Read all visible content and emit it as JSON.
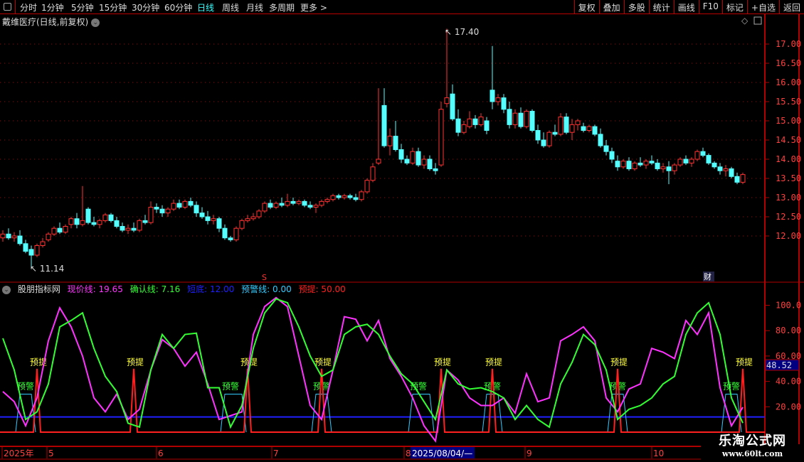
{
  "toolbar": {
    "periods": [
      "分时",
      "1分钟",
      "5分钟",
      "15分钟",
      "30分钟",
      "60分钟",
      "日线",
      "周线",
      "月线",
      "多周期",
      "更多 >"
    ],
    "active": "日线",
    "right_buttons": [
      "复权",
      "叠加",
      "多股",
      "统计",
      "画线",
      "F10",
      "标记",
      "+自选",
      "返回"
    ]
  },
  "title": "戴维医疗(日线,前复权)",
  "price_axis": {
    "ticks": [
      "17.00",
      "16.50",
      "16.00",
      "15.50",
      "15.00",
      "14.50",
      "14.00",
      "13.50",
      "13.00",
      "12.50",
      "12.00"
    ]
  },
  "annotations": {
    "high": "17.40",
    "low": "11.14",
    "s_marker": "S",
    "cai_marker": "财"
  },
  "colors": {
    "up": "#ff3232",
    "down": "#54ffff",
    "frame": "#b00000",
    "axis_text": "#ff4040",
    "xianjia": "#ff33ff",
    "queren": "#33ff33",
    "duandi": "#1f1fff",
    "yujing": "#33ccff",
    "yuti": "#ff2020",
    "label_yellow": "#ffff33"
  },
  "chart_data": [
    {
      "type": "candlestick",
      "title": "戴维医疗(日线,前复权)",
      "ylim": [
        11.0,
        17.6
      ],
      "candles": [
        [
          11.95,
          12.15,
          11.85,
          12.05
        ],
        [
          12.05,
          12.2,
          11.9,
          11.95
        ],
        [
          11.95,
          12.1,
          11.85,
          12.0
        ],
        [
          12.0,
          12.15,
          11.75,
          11.8
        ],
        [
          11.8,
          11.9,
          11.55,
          11.6
        ],
        [
          11.65,
          11.75,
          11.14,
          11.5
        ],
        [
          11.5,
          11.8,
          11.45,
          11.75
        ],
        [
          11.75,
          11.95,
          11.7,
          11.85
        ],
        [
          11.9,
          12.1,
          11.85,
          12.05
        ],
        [
          12.05,
          12.25,
          12.0,
          12.2
        ],
        [
          12.2,
          12.35,
          12.05,
          12.1
        ],
        [
          12.1,
          12.3,
          12.05,
          12.25
        ],
        [
          12.3,
          12.5,
          12.2,
          12.45
        ],
        [
          12.45,
          12.6,
          12.2,
          12.3
        ],
        [
          12.3,
          13.3,
          12.25,
          12.4
        ],
        [
          12.7,
          12.75,
          12.3,
          12.35
        ],
        [
          12.35,
          12.5,
          12.25,
          12.3
        ],
        [
          12.3,
          12.45,
          12.2,
          12.4
        ],
        [
          12.4,
          12.6,
          12.35,
          12.55
        ],
        [
          12.55,
          12.6,
          12.35,
          12.4
        ],
        [
          12.4,
          12.5,
          12.2,
          12.25
        ],
        [
          12.25,
          12.35,
          12.1,
          12.15
        ],
        [
          12.15,
          12.3,
          12.05,
          12.2
        ],
        [
          12.2,
          12.35,
          12.1,
          12.15
        ],
        [
          12.15,
          12.45,
          12.1,
          12.4
        ],
        [
          12.4,
          12.55,
          12.3,
          12.35
        ],
        [
          12.35,
          12.9,
          12.3,
          12.75
        ],
        [
          12.75,
          12.85,
          12.6,
          12.7
        ],
        [
          12.7,
          12.8,
          12.5,
          12.6
        ],
        [
          12.6,
          12.75,
          12.5,
          12.7
        ],
        [
          12.7,
          12.95,
          12.65,
          12.85
        ],
        [
          12.85,
          12.95,
          12.7,
          12.75
        ],
        [
          12.75,
          12.95,
          12.7,
          12.9
        ],
        [
          12.9,
          13.0,
          12.75,
          12.8
        ],
        [
          12.8,
          12.9,
          12.5,
          12.6
        ],
        [
          12.6,
          12.75,
          12.45,
          12.5
        ],
        [
          12.5,
          12.65,
          12.3,
          12.4
        ],
        [
          12.4,
          12.55,
          12.3,
          12.45
        ],
        [
          12.45,
          12.5,
          12.1,
          12.2
        ],
        [
          12.2,
          12.3,
          11.9,
          11.95
        ],
        [
          11.95,
          12.0,
          11.85,
          11.9
        ],
        [
          11.9,
          12.25,
          11.85,
          12.2
        ],
        [
          12.2,
          12.45,
          12.15,
          12.4
        ],
        [
          12.4,
          12.55,
          12.35,
          12.45
        ],
        [
          12.45,
          12.6,
          12.4,
          12.5
        ],
        [
          12.5,
          12.7,
          12.45,
          12.65
        ],
        [
          12.65,
          12.9,
          12.6,
          12.85
        ],
        [
          12.85,
          12.95,
          12.7,
          12.75
        ],
        [
          12.75,
          12.9,
          12.7,
          12.85
        ],
        [
          12.85,
          13.0,
          12.75,
          12.8
        ],
        [
          12.8,
          13.1,
          12.75,
          12.9
        ],
        [
          12.9,
          13.0,
          12.8,
          12.85
        ],
        [
          12.85,
          12.95,
          12.8,
          12.9
        ],
        [
          12.9,
          12.95,
          12.75,
          12.8
        ],
        [
          12.8,
          12.9,
          12.7,
          12.75
        ],
        [
          12.75,
          12.85,
          12.6,
          12.8
        ],
        [
          12.8,
          12.95,
          12.75,
          12.9
        ],
        [
          12.9,
          13.0,
          12.85,
          12.95
        ],
        [
          12.95,
          13.1,
          12.9,
          13.05
        ],
        [
          13.05,
          13.1,
          12.95,
          13.0
        ],
        [
          13.0,
          13.1,
          12.95,
          13.05
        ],
        [
          13.05,
          13.1,
          12.95,
          13.0
        ],
        [
          13.0,
          13.1,
          12.9,
          12.95
        ],
        [
          12.95,
          13.2,
          12.9,
          13.15
        ],
        [
          13.15,
          13.5,
          13.1,
          13.45
        ],
        [
          13.45,
          13.9,
          13.4,
          13.8
        ],
        [
          13.9,
          15.85,
          13.85,
          14.0
        ],
        [
          15.4,
          15.85,
          14.3,
          14.35
        ],
        [
          14.35,
          14.8,
          14.1,
          14.6
        ],
        [
          14.6,
          15.0,
          14.2,
          14.25
        ],
        [
          14.25,
          14.4,
          13.9,
          14.0
        ],
        [
          14.0,
          14.1,
          13.85,
          13.9
        ],
        [
          13.9,
          14.3,
          13.85,
          14.2
        ],
        [
          14.2,
          14.3,
          13.8,
          13.85
        ],
        [
          13.85,
          14.1,
          13.75,
          14.0
        ],
        [
          14.0,
          14.1,
          13.7,
          13.75
        ],
        [
          13.75,
          13.9,
          13.6,
          13.7
        ],
        [
          13.85,
          15.5,
          13.8,
          15.3
        ],
        [
          15.45,
          17.4,
          15.35,
          15.6
        ],
        [
          15.7,
          15.95,
          15.0,
          15.05
        ],
        [
          15.05,
          15.3,
          14.6,
          14.7
        ],
        [
          14.7,
          15.0,
          14.65,
          14.9
        ],
        [
          14.85,
          15.25,
          14.8,
          15.05
        ],
        [
          15.05,
          15.15,
          14.8,
          14.9
        ],
        [
          14.9,
          15.2,
          14.85,
          15.1
        ],
        [
          15.0,
          15.1,
          14.65,
          14.75
        ],
        [
          15.8,
          16.95,
          15.3,
          15.5
        ],
        [
          15.5,
          15.7,
          15.4,
          15.6
        ],
        [
          15.6,
          15.7,
          15.2,
          15.3
        ],
        [
          15.3,
          15.5,
          14.8,
          14.9
        ],
        [
          14.9,
          15.3,
          14.8,
          15.2
        ],
        [
          15.2,
          15.35,
          14.8,
          14.85
        ],
        [
          14.85,
          15.3,
          14.8,
          15.25
        ],
        [
          15.25,
          15.3,
          14.7,
          14.75
        ],
        [
          14.75,
          14.9,
          14.4,
          14.5
        ],
        [
          14.5,
          14.7,
          14.3,
          14.35
        ],
        [
          14.35,
          14.75,
          14.3,
          14.7
        ],
        [
          14.7,
          14.9,
          14.6,
          14.65
        ],
        [
          14.65,
          15.2,
          14.6,
          15.1
        ],
        [
          15.1,
          15.2,
          14.65,
          14.7
        ],
        [
          14.7,
          15.05,
          14.5,
          14.9
        ],
        [
          14.9,
          15.05,
          14.75,
          15.0
        ],
        [
          14.85,
          14.95,
          14.7,
          14.75
        ],
        [
          14.75,
          14.9,
          14.7,
          14.85
        ],
        [
          14.85,
          14.9,
          14.6,
          14.65
        ],
        [
          14.65,
          14.8,
          14.3,
          14.35
        ],
        [
          14.35,
          14.5,
          14.1,
          14.2
        ],
        [
          14.2,
          14.3,
          13.9,
          14.0
        ],
        [
          13.95,
          14.1,
          13.7,
          13.8
        ],
        [
          13.8,
          14.0,
          13.75,
          13.95
        ],
        [
          13.95,
          14.05,
          13.7,
          13.75
        ],
        [
          13.75,
          13.95,
          13.7,
          13.9
        ],
        [
          13.9,
          14.05,
          13.8,
          13.85
        ],
        [
          13.85,
          14.0,
          13.75,
          13.95
        ],
        [
          13.95,
          14.1,
          13.85,
          13.9
        ],
        [
          13.9,
          14.0,
          13.7,
          13.75
        ],
        [
          13.75,
          13.9,
          13.65,
          13.8
        ],
        [
          13.8,
          13.95,
          13.35,
          13.7
        ],
        [
          13.7,
          13.9,
          13.6,
          13.85
        ],
        [
          13.85,
          14.05,
          13.8,
          14.0
        ],
        [
          14.0,
          14.1,
          13.85,
          13.9
        ],
        [
          13.9,
          14.05,
          13.8,
          14.0
        ],
        [
          14.0,
          14.25,
          13.95,
          14.2
        ],
        [
          14.2,
          14.3,
          14.05,
          14.1
        ],
        [
          14.1,
          14.15,
          13.85,
          13.9
        ],
        [
          13.9,
          13.95,
          13.75,
          13.8
        ],
        [
          13.8,
          13.9,
          13.6,
          13.7
        ],
        [
          13.7,
          13.85,
          13.55,
          13.75
        ],
        [
          13.75,
          13.8,
          13.5,
          13.55
        ],
        [
          13.55,
          13.65,
          13.35,
          13.4
        ],
        [
          13.4,
          13.65,
          13.35,
          13.6
        ]
      ]
    },
    {
      "type": "line",
      "title": "股朋指标网",
      "ylim": [
        0,
        110
      ],
      "ticks": [
        "100.0",
        "80.00",
        "60.00",
        "40.00",
        "20.00"
      ],
      "current_value": "48.52",
      "bar_step": 2,
      "series": [
        {
          "name": "现价线",
          "label": "现价线: 19.65",
          "values": [
            32,
            24,
            5,
            27,
            72,
            98,
            83,
            60,
            27,
            16,
            30,
            10,
            18,
            49,
            73,
            66,
            52,
            63,
            38,
            10,
            13,
            16,
            77,
            99,
            106,
            99,
            60,
            21,
            10,
            49,
            91,
            89,
            72,
            88,
            58,
            44,
            27,
            5,
            -7,
            49,
            41,
            27,
            21,
            21,
            27,
            15,
            46,
            24,
            27,
            72,
            77,
            83,
            72,
            27,
            16,
            34,
            38,
            66,
            63,
            58,
            88,
            77,
            94,
            35,
            5,
            19.65
          ]
        },
        {
          "name": "确认线",
          "label": "确认线: 7.16",
          "values": [
            74,
            49,
            10,
            16,
            38,
            83,
            88,
            94,
            66,
            44,
            32,
            7,
            4,
            49,
            77,
            66,
            77,
            78,
            35,
            35,
            4,
            21,
            66,
            94,
            105,
            102,
            83,
            60,
            44,
            49,
            77,
            83,
            85,
            77,
            60,
            46,
            38,
            24,
            10,
            49,
            38,
            34,
            35,
            32,
            27,
            10,
            21,
            10,
            4,
            38,
            55,
            77,
            69,
            49,
            10,
            18,
            21,
            27,
            38,
            44,
            77,
            94,
            102,
            77,
            27,
            7.16
          ]
        },
        {
          "name": "短底",
          "label": "短底: 12.00",
          "value": 12
        },
        {
          "name": "预警线",
          "label": "预警线: 0.00",
          "pulse_level": 30,
          "pulse_bars": [
            [
              3,
              5
            ],
            [
              39,
              42
            ],
            [
              55,
              57
            ],
            [
              72,
              75
            ],
            [
              85,
              87
            ],
            [
              107,
              109
            ],
            [
              127,
              129
            ]
          ],
          "tag": "预警"
        },
        {
          "name": "预提",
          "label": "预提: 50.00",
          "spike_level": 50,
          "spike_bars": [
            6,
            23,
            43,
            56,
            77,
            86,
            108,
            130
          ],
          "tag": "预提"
        }
      ]
    }
  ],
  "time_axis": {
    "labels": [
      "2025年",
      "5",
      "6",
      "7",
      "8",
      "9",
      "10"
    ],
    "cursor_date": "2025/08/04/—"
  },
  "indicator": {
    "name": "股朋指标网"
  },
  "watermark": {
    "line1": "乐淘公式网",
    "line2": "www.60lt.com"
  }
}
